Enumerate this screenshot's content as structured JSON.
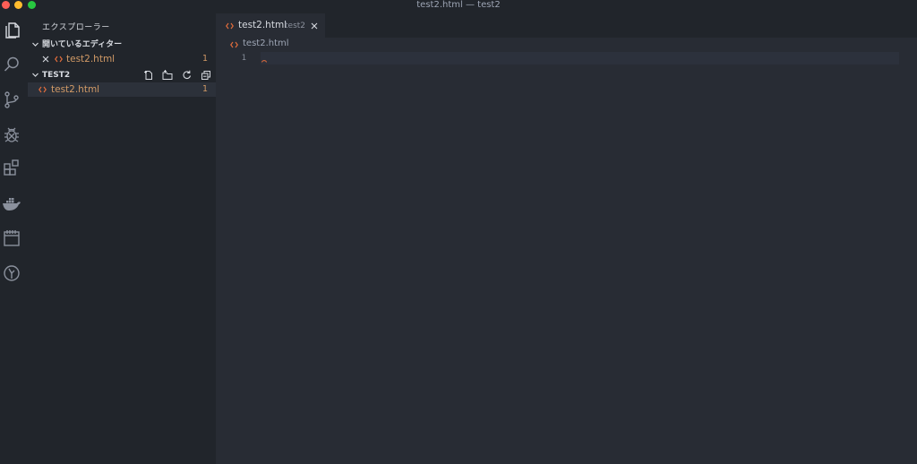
{
  "window": {
    "title": "test2.html — test2"
  },
  "activity_bar": {
    "icons": [
      "files-icon",
      "search-icon",
      "source-control-icon",
      "debug-icon",
      "extensions-icon",
      "docker-icon",
      "calendar-icon",
      "git-graph-icon"
    ]
  },
  "sidebar": {
    "title": "エクスプローラー",
    "open_editors": {
      "header": "開いているエディター",
      "items": [
        {
          "name": "test2.html",
          "count": "1"
        }
      ]
    },
    "folder": {
      "header": "TEST2",
      "items": [
        {
          "name": "test2.html",
          "count": "1"
        }
      ]
    }
  },
  "tabs": [
    {
      "label": "test2.html",
      "description": "test2"
    }
  ],
  "breadcrumb": {
    "file": "test2.html"
  },
  "editor": {
    "line_number": "1"
  },
  "colors": {
    "file_accent": "#d19a66",
    "html_icon": "#e06c3c",
    "background": "#282c34",
    "sidebar": "#21252b"
  }
}
